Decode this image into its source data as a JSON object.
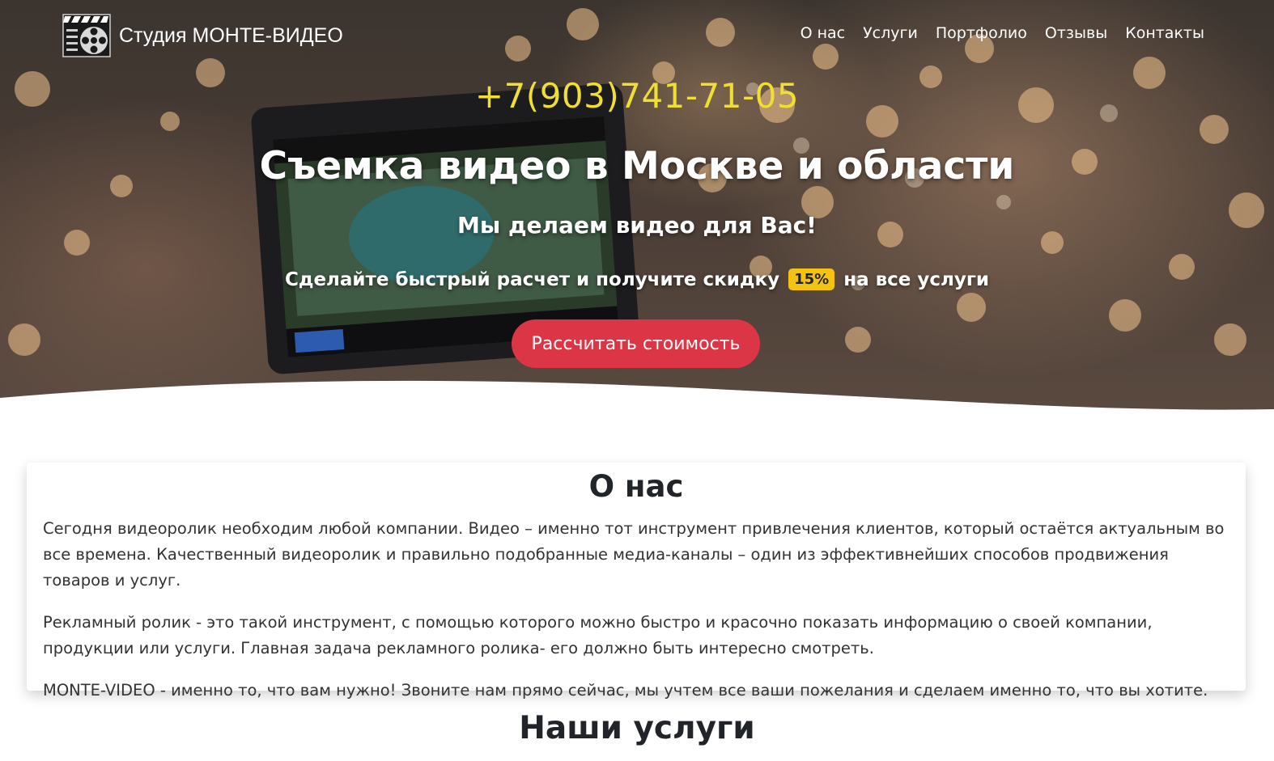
{
  "header": {
    "brand_name": "Студия МОНТЕ-ВИДЕО",
    "logo_icon": "film-reel-clapperboard-icon",
    "nav": [
      {
        "label": "О нас"
      },
      {
        "label": "Услуги"
      },
      {
        "label": "Портфолио"
      },
      {
        "label": "Отзывы"
      },
      {
        "label": "Контакты"
      }
    ]
  },
  "hero": {
    "phone": "+7(903)741-71-05",
    "title": "Съемка видео в Москве и области",
    "subtitle": "Мы делаем видео для Вас!",
    "offer_before": "Сделайте быстрый расчет и получите скидку",
    "discount": "15%",
    "offer_after": "на все услуги",
    "cta_label": "Рассчитать стоимость",
    "background_image": "camera-monitor-bokeh-photo"
  },
  "about": {
    "title": "О нас",
    "paragraphs": [
      "Сегодня видеоролик необходим любой компании. Видео – именно тот инструмент привлечения клиентов, который остаётся актуальным во все времена. Качественный видеоролик и правильно подобранные медиа-каналы – один из эффективнейших способов продвижения товаров и услуг.",
      "Рекламный ролик - это такой инструмент, с помощью которого можно быстро и красочно показать информацию о своей компании, продукции или услуги. Главная задача рекламного ролика- его должно быть интересно смотреть.",
      "MONTE-VIDEO - именно то, что вам нужно! Звоните нам прямо сейчас, мы учтем все ваши пожелания и сделаем именно то, что вы хотите."
    ]
  },
  "services": {
    "title": "Наши услуги"
  },
  "colors": {
    "phone": "#f0de33",
    "cta": "#dc3545",
    "badge": "#f5c210"
  }
}
